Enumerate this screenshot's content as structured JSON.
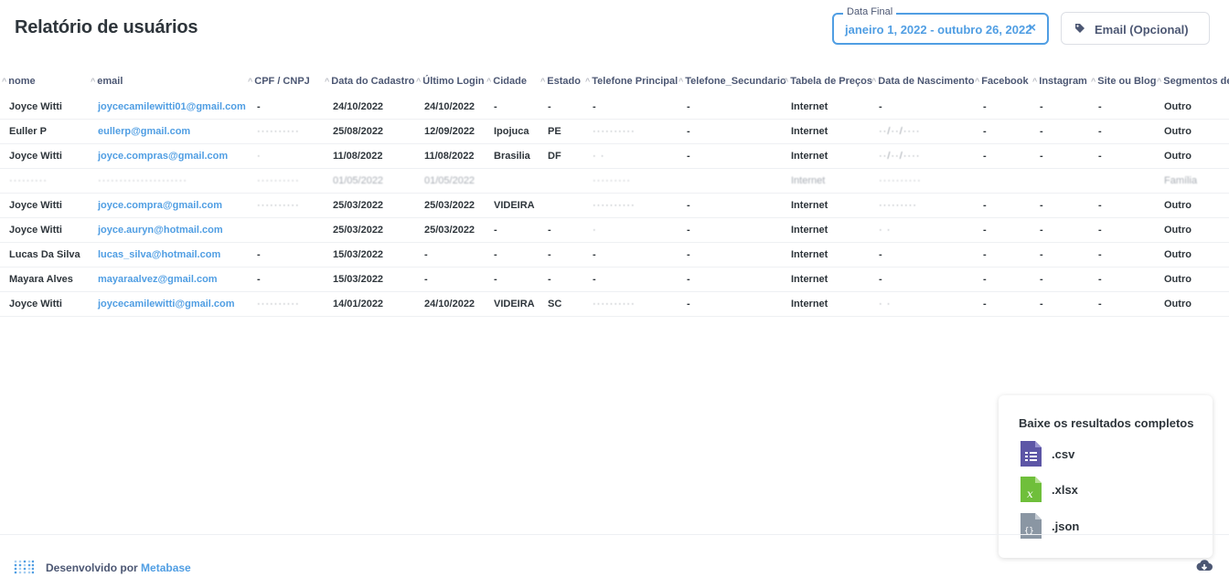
{
  "header": {
    "title": "Relatório de usuários"
  },
  "filters": {
    "date": {
      "legend": "Data Final",
      "value": "janeiro 1, 2022 - outubro 26, 2022",
      "clear": "×"
    },
    "email": {
      "label": "Email (Opcional)"
    }
  },
  "table": {
    "columns": [
      "nome",
      "email",
      "CPF / CNPJ",
      "Data do Cadastro",
      "Último Login",
      "Cidade",
      "Estado",
      "Telefone Principal",
      "Telefone_Secundario",
      "Tabela de Preços",
      "Data de Nascimento",
      "Facebook",
      "Instagram",
      "Site ou Blog",
      "Segmentos de A"
    ],
    "rows": [
      [
        "Joyce Witti",
        "joycecamilewitti01@gmail.com",
        "-",
        "24/10/2022",
        "24/10/2022",
        "-",
        "-",
        "-",
        "-",
        "Internet",
        "-",
        "-",
        "-",
        "-",
        "Outro"
      ],
      [
        "Euller P",
        "eullerp@gmail.com",
        "··········",
        "25/08/2022",
        "12/09/2022",
        "Ipojuca",
        "PE",
        "··········",
        "-",
        "Internet",
        "··/··/····",
        "-",
        "-",
        "-",
        "Outro"
      ],
      [
        "Joyce Witti",
        "joyce.compras@gmail.com",
        "·",
        "11/08/2022",
        "11/08/2022",
        "Brasilia",
        "DF",
        "·          ·",
        "-",
        "Internet",
        "··/··/····",
        "-",
        "-",
        "-",
        "Outro"
      ],
      [
        "·········",
        "·····················",
        "··········",
        "01/05/2022",
        "01/05/2022",
        "",
        "",
        "·········",
        "",
        "Internet",
        "··········",
        "",
        "",
        "",
        "Família"
      ],
      [
        "Joyce Witti",
        "joyce.compra@gmail.com",
        "··········",
        "25/03/2022",
        "25/03/2022",
        "VIDEIRA",
        "",
        "··········",
        "-",
        "Internet",
        "·········",
        "-",
        "-",
        "-",
        "Outro"
      ],
      [
        "Joyce Witti",
        "joyce.auryn@hotmail.com",
        "",
        "25/03/2022",
        "25/03/2022",
        "-",
        "-",
        "·",
        "-",
        "Internet",
        "·         ·",
        "-",
        "-",
        "-",
        "Outro"
      ],
      [
        "Lucas Da Silva",
        "lucas_silva@hotmail.com",
        "-",
        "15/03/2022",
        "-",
        "-",
        "-",
        "-",
        "-",
        "Internet",
        "-",
        "-",
        "-",
        "-",
        "Outro"
      ],
      [
        "Mayara Alves",
        "mayaraalvez@gmail.com",
        "-",
        "15/03/2022",
        "-",
        "-",
        "-",
        "-",
        "-",
        "Internet",
        "-",
        "-",
        "-",
        "-",
        "Outro"
      ],
      [
        "Joyce Witti",
        "joycecamilewitti@gmail.com",
        "··········",
        "14/01/2022",
        "24/10/2022",
        "VIDEIRA",
        "SC",
        "··········",
        "-",
        "Internet",
        "·        ·",
        "-",
        "-",
        "-",
        "Outro"
      ]
    ]
  },
  "download": {
    "title": "Baixe os resultados completos",
    "formats": [
      {
        "ext": ".csv",
        "icon": "csv-file-icon",
        "color": "#5d56a6"
      },
      {
        "ext": ".xlsx",
        "icon": "xlsx-file-icon",
        "color": "#6fbf3b"
      },
      {
        "ext": ".json",
        "icon": "json-file-icon",
        "color": "#8a96a3"
      }
    ]
  },
  "footer": {
    "credit_prefix": "Desenvolvido por ",
    "brand": "Metabase"
  },
  "colors": {
    "accent": "#509ee3",
    "text": "#2e353b",
    "muted": "#4c5773"
  }
}
